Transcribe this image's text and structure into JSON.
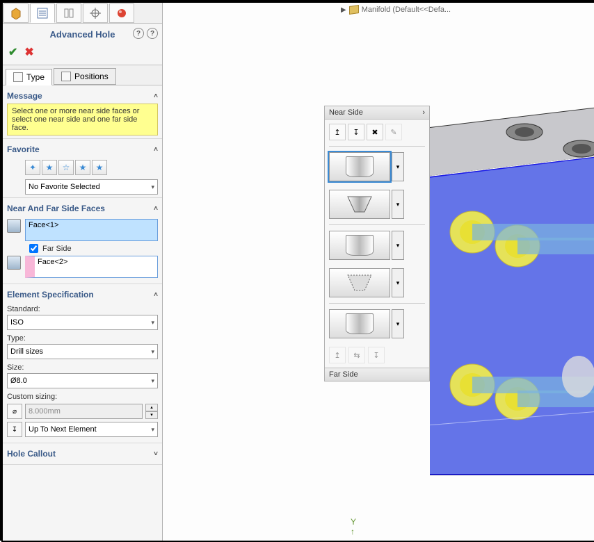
{
  "tree_hint": "Manifold  (Default<<Defa...",
  "panel_title": "Advanced Hole",
  "tabs": {
    "type": "Type",
    "positions": "Positions"
  },
  "message": {
    "header": "Message",
    "text": "Select one or more near side faces or select one near side and one far side face."
  },
  "favorite": {
    "header": "Favorite",
    "selected": "No Favorite Selected"
  },
  "faces": {
    "header": "Near And Far Side Faces",
    "face1": "Face<1>",
    "farside_label": "Far Side",
    "face2": "Face<2>"
  },
  "elementSpec": {
    "header": "Element Specification",
    "std_label": "Standard:",
    "std_value": "ISO",
    "type_label": "Type:",
    "type_value": "Drill sizes",
    "size_label": "Size:",
    "size_value": "Ø8.0",
    "custom_label": "Custom sizing:",
    "custom_value": "8.000mm",
    "depth_value": "Up To Next Element"
  },
  "holeCallout": {
    "header": "Hole Callout"
  },
  "nearSide": {
    "header": "Near Side"
  },
  "farSide": {
    "header": "Far Side"
  },
  "axis": "Y"
}
